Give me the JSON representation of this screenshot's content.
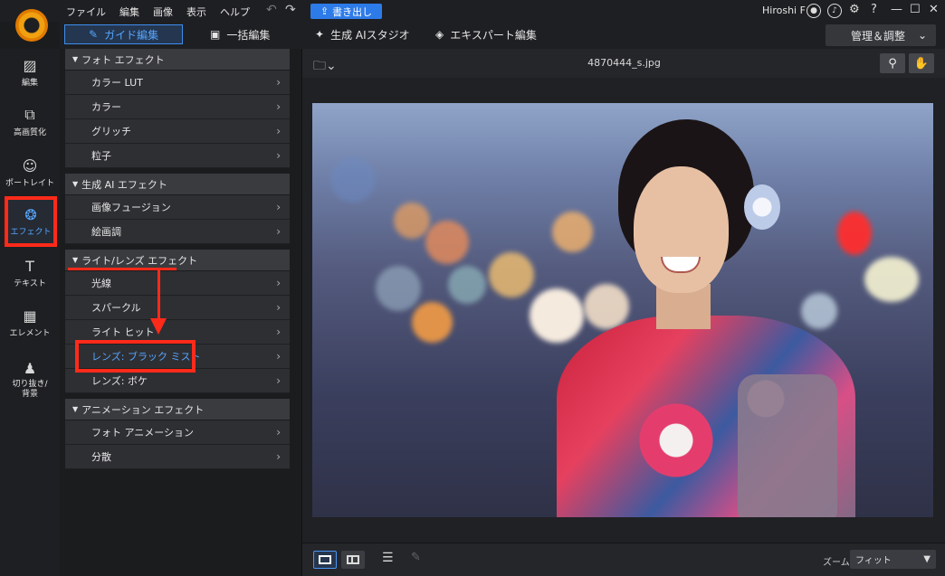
{
  "menu": [
    "ファイル",
    "編集",
    "画像",
    "表示",
    "ヘルプ"
  ],
  "export_label": "書き出し",
  "user_name": "Hiroshi F",
  "modes": [
    {
      "label": "ガイド編集",
      "active": true
    },
    {
      "label": "一括編集",
      "active": false
    },
    {
      "label": "生成 AIスタジオ",
      "active": false
    },
    {
      "label": "エキスパート編集",
      "active": false
    }
  ],
  "manage_label": "管理＆調整",
  "nav": [
    {
      "label": "編集",
      "icon": "edit-icon"
    },
    {
      "label": "高画質化",
      "icon": "enhance-icon"
    },
    {
      "label": "ポートレイト",
      "icon": "portrait-icon"
    },
    {
      "label": "エフェクト",
      "icon": "effects-icon",
      "active": true
    },
    {
      "label": "テキスト",
      "icon": "text-icon"
    },
    {
      "label": "エレメント",
      "icon": "element-icon"
    },
    {
      "label": "切り抜き/\n背景",
      "icon": "cutout-icon"
    }
  ],
  "groups": [
    {
      "title": "フォト エフェクト",
      "items": [
        "カラー LUT",
        "カラー",
        "グリッチ",
        "粒子"
      ]
    },
    {
      "title": "生成 AI エフェクト",
      "items": [
        "画像フュージョン",
        "絵画調"
      ]
    },
    {
      "title": "ライト/レンズ エフェクト",
      "items": [
        "光線",
        "スパークル",
        "ライト ヒット",
        "レンズ: ブラック ミスト",
        "レンズ: ボケ"
      ]
    },
    {
      "title": "アニメーション エフェクト",
      "items": [
        "フォト アニメーション",
        "分散"
      ]
    }
  ],
  "selected_item": "レンズ: ブラック ミスト",
  "file_name": "4870444_s.jpg",
  "zoom": {
    "label": "ズーム:",
    "value": "フィット"
  },
  "accent_color": "#56a6ff",
  "highlight_color": "#ff2a1a"
}
